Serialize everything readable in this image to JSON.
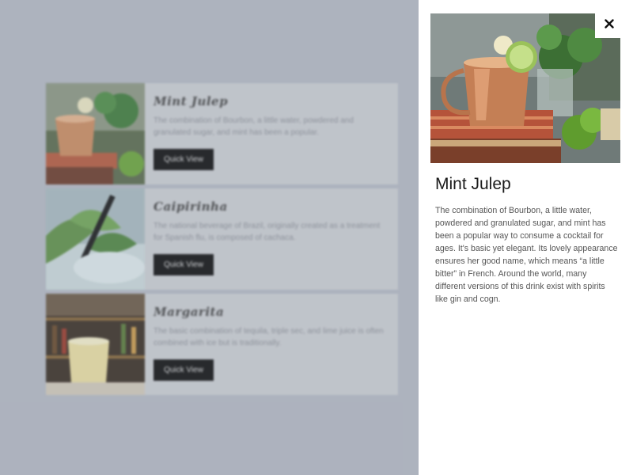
{
  "list": {
    "items": [
      {
        "title": "Mint Julep",
        "description": "The combination of Bourbon, a little water, powdered and granulated sugar, and mint has been a popular.",
        "button_label": "Quick View"
      },
      {
        "title": "Caipirinha",
        "description": "The national beverage of Brazil, originally created as a treatment for Spanish flu, is composed of cachaca.",
        "button_label": "Quick View"
      },
      {
        "title": "Margarita",
        "description": "The basic combination of tequila, triple sec, and lime juice is often combined with ice but is traditionally.",
        "button_label": "Quick View"
      }
    ]
  },
  "detail": {
    "title": "Mint Julep",
    "description": "The combination of Bourbon, a little water, powdered and granulated sugar, and mint has been a popular way to consume a cocktail for ages. It's basic yet elegant. Its lovely appearance ensures her good name, which means “a little bitter” in French. Around the world, many different versions of this drink exist with spirits like gin and cogn.",
    "close_icon": "close-icon"
  }
}
